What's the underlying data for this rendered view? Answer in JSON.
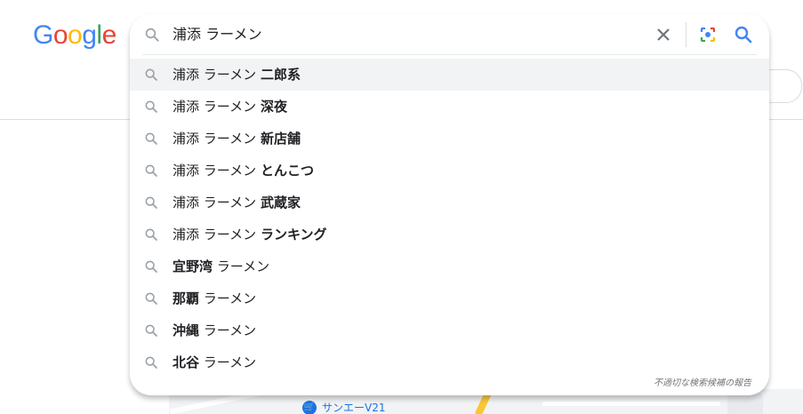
{
  "logo": {
    "letters": [
      "G",
      "o",
      "o",
      "g",
      "l",
      "e"
    ],
    "colors": [
      "#4285f4",
      "#ea4335",
      "#fbbc05",
      "#4285f4",
      "#34a853",
      "#ea4335"
    ]
  },
  "search": {
    "query": "浦添 ラーメン"
  },
  "suggestions": [
    {
      "plain_before": "浦添 ラーメン ",
      "bold": "二郎系",
      "plain_after": ""
    },
    {
      "plain_before": "浦添 ラーメン ",
      "bold": "深夜",
      "plain_after": ""
    },
    {
      "plain_before": "浦添 ラーメン ",
      "bold": "新店舗",
      "plain_after": ""
    },
    {
      "plain_before": "浦添 ラーメン ",
      "bold": "とんこつ",
      "plain_after": ""
    },
    {
      "plain_before": "浦添 ラーメン ",
      "bold": "武蔵家",
      "plain_after": ""
    },
    {
      "plain_before": "浦添 ラーメン ",
      "bold": "ランキング",
      "plain_after": ""
    },
    {
      "plain_before": "",
      "bold": "宜野湾",
      "plain_after": " ラーメン"
    },
    {
      "plain_before": "",
      "bold": "那覇",
      "plain_after": " ラーメン"
    },
    {
      "plain_before": "",
      "bold": "沖縄",
      "plain_after": " ラーメン"
    },
    {
      "plain_before": "",
      "bold": "北谷",
      "plain_after": " ラーメン"
    }
  ],
  "report_link": "不適切な検索候補の報告",
  "map": {
    "poi_label": "サンエーV21"
  },
  "icons": {
    "search": "search-icon",
    "clear": "close-icon",
    "lens": "camera-lens-icon",
    "go": "search-icon"
  },
  "colors": {
    "highlight": "#f1f3f4",
    "accent": "#1a73e8"
  }
}
